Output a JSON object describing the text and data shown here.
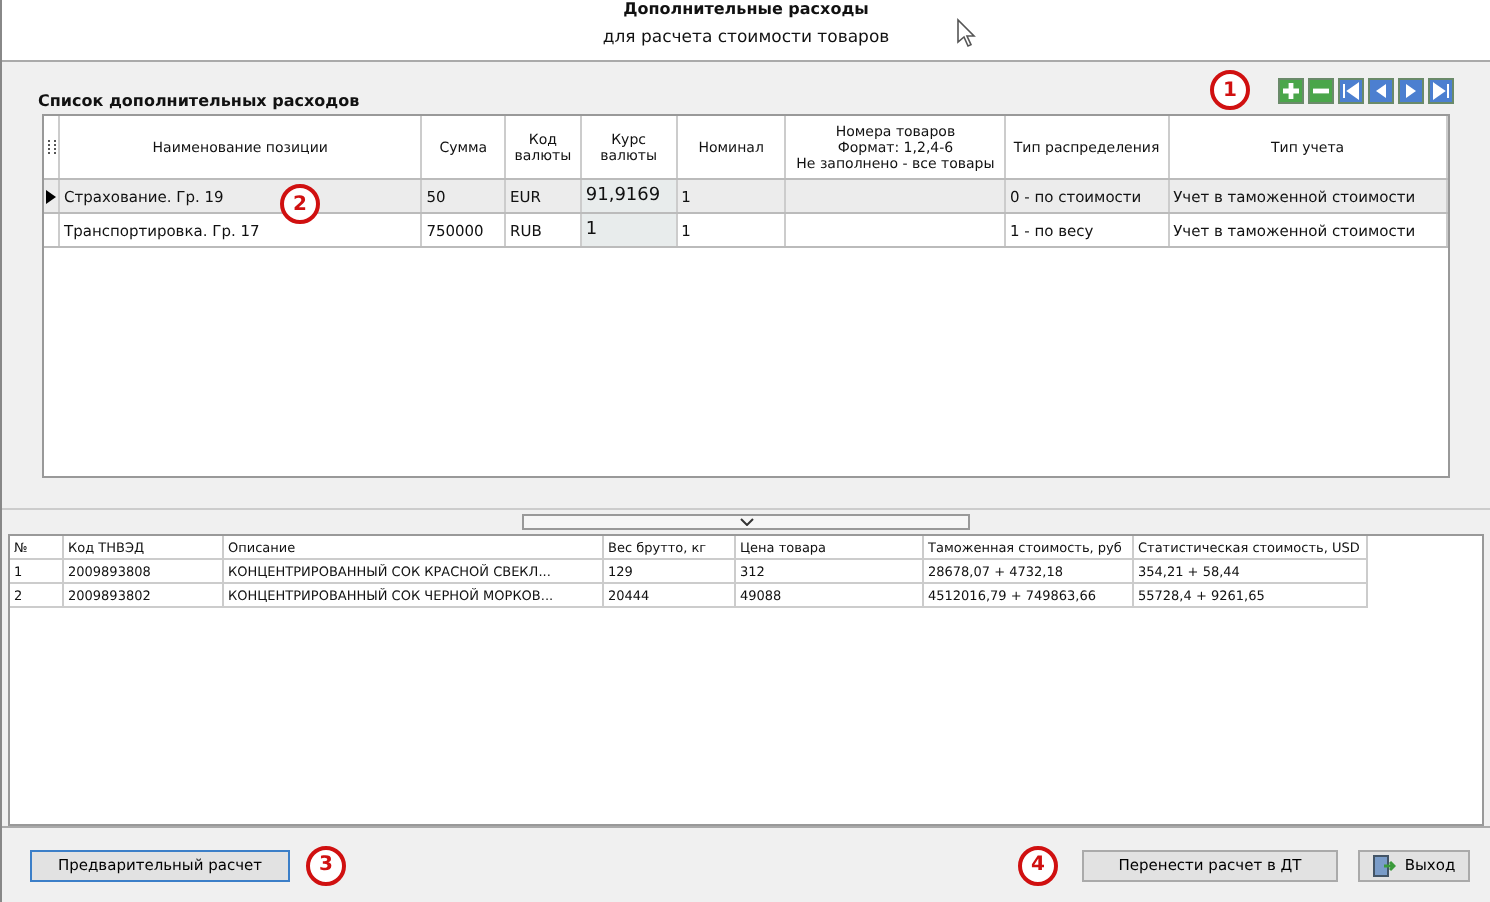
{
  "header": {
    "title": "Дополнительные расходы",
    "subtitle": "для расчета стоимости товаров"
  },
  "group": {
    "title": "Список дополнительных расходов",
    "toolbar_callout": "1"
  },
  "expenses": {
    "columns": [
      "Наименование позиции",
      "Сумма",
      "Код валюты",
      "Курс валюты",
      "Номинал",
      "Номера товаров\nФормат: 1,2,4-6\nНе заполнено - все товары",
      "Тип распределения",
      "Тип учета"
    ],
    "rows": [
      {
        "selected": true,
        "callout": "2",
        "cells": [
          "Страхование. Гр. 19",
          "50",
          "EUR",
          "91,9169",
          "1",
          "",
          "0 - по стоимости",
          "Учет в таможенной стоимости"
        ]
      },
      {
        "selected": false,
        "cells": [
          "Транспортировка. Гр. 17",
          "750000",
          "RUB",
          "1",
          "1",
          "",
          "1 - по весу",
          "Учет в таможенной стоимости"
        ]
      }
    ]
  },
  "goods": {
    "columns": [
      "№",
      "Код ТНВЭД",
      "Описание",
      "Вес брутто, кг",
      "Цена товара",
      "Таможенная стоимость, руб",
      "Статистическая стоимость, USD"
    ],
    "rows": [
      [
        "1",
        "2009893808",
        "КОНЦЕНТРИРОВАННЫЙ СОК КРАСНОЙ СВЕКЛ...",
        "129",
        "312",
        "28678,07 + 4732,18",
        "354,21 + 58,44"
      ],
      [
        "2",
        "2009893802",
        "КОНЦЕНТРИРОВАННЫЙ СОК ЧЕРНОЙ МОРКОВ...",
        "20444",
        "49088",
        "4512016,79 + 749863,66",
        "55728,4 + 9261,65"
      ]
    ]
  },
  "footer": {
    "left": {
      "label": "Предварительный расчет",
      "callout": "3"
    },
    "right": [
      {
        "kind": "plain",
        "label": "Перенести расчет в ДТ",
        "callout": "4"
      },
      {
        "kind": "exit",
        "label": "Выход"
      }
    ]
  }
}
